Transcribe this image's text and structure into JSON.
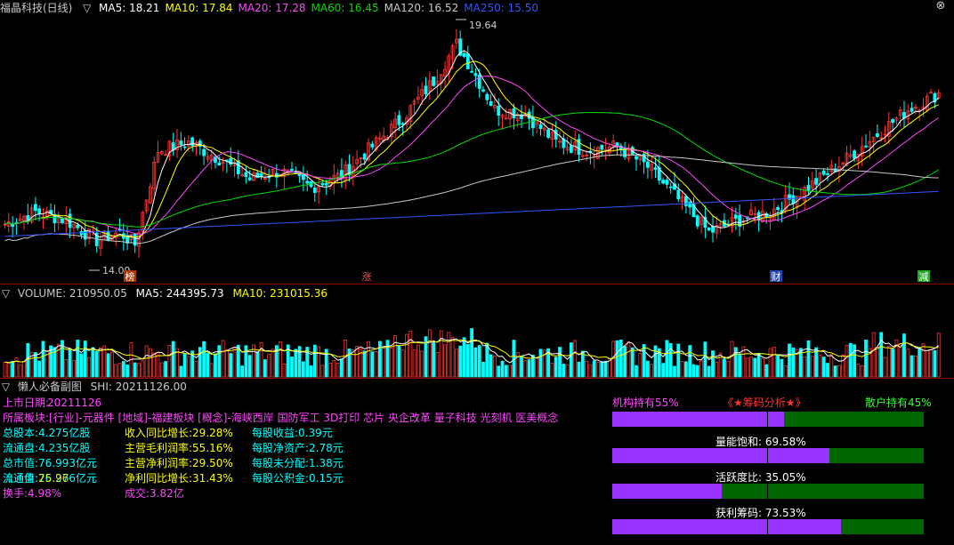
{
  "header": {
    "stock": "福晶科技(日线)",
    "ma": [
      {
        "label": "MA5: 18.21",
        "color": "#ffffff"
      },
      {
        "label": "MA10: 17.84",
        "color": "#ffff00"
      },
      {
        "label": "MA20: 17.28",
        "color": "#ff44ff"
      },
      {
        "label": "MA60: 16.45",
        "color": "#00dd00"
      },
      {
        "label": "MA120: 16.52",
        "color": "#c8c8c8"
      },
      {
        "label": "MA250: 15.50",
        "color": "#3355ff"
      }
    ]
  },
  "price_chart": {
    "high_label": "19.64",
    "low_label": "14.09",
    "markers": [
      {
        "text": "榜",
        "bg": "#aa3300",
        "fg": "#ffffff"
      },
      {
        "text": "涨",
        "bg": "#000000",
        "fg": "#ff4444"
      },
      {
        "text": "财",
        "bg": "#2244aa",
        "fg": "#ffffff"
      },
      {
        "text": "减",
        "bg": "#22aa22",
        "fg": "#ffffff"
      }
    ]
  },
  "volume": {
    "label": "VOLUME: 210950.05",
    "ma5": "MA5: 244395.73",
    "ma10": "MA10: 231015.36"
  },
  "subchart": {
    "title": "懒人必备副图",
    "shi": "SHI: 20211126.00"
  },
  "info": {
    "listing_label": "上市日期:",
    "listing_value": "20211126",
    "sector_label": "所属板块:",
    "sector_text": "[行业]-元器件 [地域]-福建板块 [概念]-海峡西岸 国防军工 3D打印 芯片 央企改革 量子科技 光刻机 医美概念",
    "col1": [
      {
        "l": "总股本:",
        "v": "4.275亿股"
      },
      {
        "l": "流通盘:",
        "v": "4.235亿股"
      },
      {
        "l": "总市值:",
        "v": "76.993亿元"
      },
      {
        "l": "流通值:",
        "v": "76.276亿元"
      },
      {
        "l": "换手:",
        "v": "4.98%"
      }
    ],
    "overlap_label": "流通盘:",
    "overlap_value": "25.96",
    "col2": [
      {
        "l": "收入同比增长:",
        "v": "29.28%"
      },
      {
        "l": "主营毛利润率:",
        "v": "55.16%"
      },
      {
        "l": "主营净利润率:",
        "v": "29.50%"
      },
      {
        "l": "净利同比增长:",
        "v": "31.43%"
      },
      {
        "l": "成交:",
        "v": "3.82亿"
      }
    ],
    "col3": [
      {
        "l": "每股收益:",
        "v": "0.39元"
      },
      {
        "l": "每股净资产:",
        "v": "2.78元"
      },
      {
        "l": "每股未分配:",
        "v": "1.38元"
      },
      {
        "l": "每股公积金:",
        "v": "0.15元"
      }
    ]
  },
  "chip_panel": {
    "inst": "机构持有55%",
    "title": "《★筹码分析★》",
    "retail": "散户持有45%",
    "inst_frac": 0.55,
    "gauges": [
      {
        "label": "量能饱和: 69.58%",
        "frac": 0.6958
      },
      {
        "label": "活跃度比: 35.05%",
        "frac": 0.3505
      },
      {
        "label": "获利筹码: 73.53%",
        "frac": 0.7353
      }
    ]
  },
  "colors": {
    "up": "#ff3333",
    "down": "#00ffff",
    "ma5": "#ffffff",
    "ma10": "#ffff00",
    "ma20": "#ff44ff",
    "ma60": "#00dd00",
    "ma120": "#c8c8c8",
    "ma250": "#3355ff"
  }
}
